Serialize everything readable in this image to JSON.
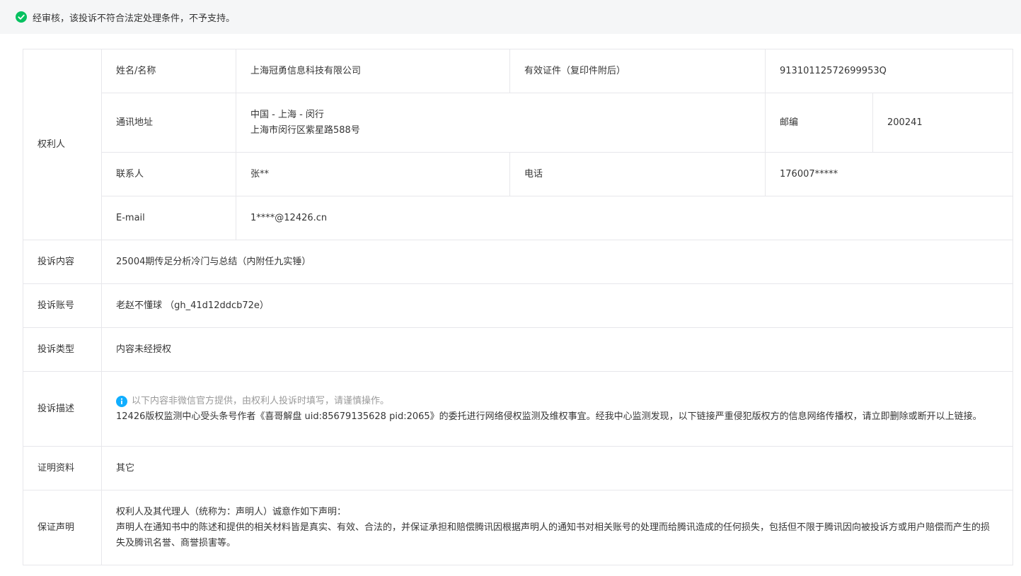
{
  "notice": {
    "text": "经审核，该投诉不符合法定处理条件，不予支持。",
    "icon": "check-circle-icon",
    "icon_color": "#07c160"
  },
  "rights_holder": {
    "section_label": "权利人",
    "name_label": "姓名/名称",
    "name_value": "上海冠勇信息科技有限公司",
    "cert_label": "有效证件（复印件附后）",
    "cert_value": "91310112572699953Q",
    "address_label": "通讯地址",
    "address_line1": "中国 - 上海 - 闵行",
    "address_line2": "上海市闵行区紫星路588号",
    "postcode_label": "邮编",
    "postcode_value": "200241",
    "contact_label": "联系人",
    "contact_value": "张**",
    "phone_label": "电话",
    "phone_value": "176007*****",
    "email_label": "E-mail",
    "email_value": "1****@12426.cn"
  },
  "complaint": {
    "content_label": "投诉内容",
    "content_value": "25004期传足分析冷门与总结（内附任九实锤）",
    "account_label": "投诉账号",
    "account_value": "老赵不懂球 （gh_41d12ddcb72e）",
    "type_label": "投诉类型",
    "type_value": "内容未经授权",
    "desc_label": "投诉描述",
    "desc_tip": "以下内容非微信官方提供，由权利人投诉时填写，请谨慎操作。",
    "desc_value": "12426版权监测中心受头条号作者《喜哥解盘 uid:85679135628 pid:2065》的委托进行网络侵权监测及维权事宜。经我中心监测发现，以下链接严重侵犯版权方的信息网络传播权，请立即删除或断开以上链接。",
    "evidence_label": "证明资料",
    "evidence_value": "其它",
    "guarantee_label": "保证声明",
    "guarantee_line1": "权利人及其代理人（统称为：声明人）诚意作如下声明：",
    "guarantee_line2": "声明人在通知书中的陈述和提供的相关材料皆是真实、有效、合法的，并保证承担和赔偿腾讯因根据声明人的通知书对相关账号的处理而给腾讯造成的任何损失，包括但不限于腾讯因向被投诉方或用户赔偿而产生的损失及腾讯名誉、商誉损害等。"
  },
  "colors": {
    "border": "#e7e7eb",
    "tip_icon": "#10aeff",
    "tip_text": "#9a9a9a",
    "notice_bg": "#f5f6f7"
  }
}
